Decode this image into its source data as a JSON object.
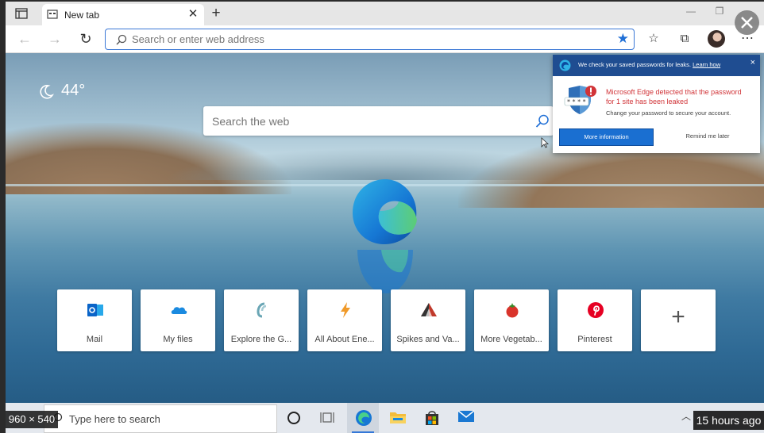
{
  "browser": {
    "tab": {
      "title": "New tab"
    },
    "new_tab_symbol": "+",
    "address_bar": {
      "placeholder": "Search or enter web address"
    },
    "icons": [
      "sidebar-icon",
      "back-icon",
      "forward-icon",
      "refresh-icon",
      "search-icon",
      "favorite-star-icon",
      "favorites-icon",
      "collections-icon",
      "profile-avatar",
      "more-icon"
    ]
  },
  "ntp": {
    "weather": {
      "temperature": "44°",
      "icon": "moon-icon"
    },
    "search": {
      "placeholder": "Search the web"
    },
    "quick_links": [
      {
        "label": "Mail",
        "icon": "outlook-icon",
        "color": "#0a64c8"
      },
      {
        "label": "My files",
        "icon": "onedrive-icon",
        "color": "#1a8ae0"
      },
      {
        "label": "Explore the G...",
        "icon": "link-icon",
        "color": "#6aa6b5"
      },
      {
        "label": "All About Ene...",
        "icon": "lightning-icon",
        "color": "#f09a2a"
      },
      {
        "label": "Spikes and Va...",
        "icon": "triangle-icon",
        "color": "#c0392b"
      },
      {
        "label": "More Vegetab...",
        "icon": "tomato-icon",
        "color": "#d9342b"
      },
      {
        "label": "Pinterest",
        "icon": "pinterest-icon",
        "color": "#e60023"
      }
    ],
    "add_tile_symbol": "+"
  },
  "popup": {
    "header_text": "We check your saved passwords for leaks.",
    "header_link": "Learn how",
    "alert_text": "Microsoft Edge detected that the password for 1 site has been leaked",
    "sub_text": "Change your password to secure your account.",
    "primary_button": "More information",
    "secondary_button": "Remind me later",
    "close_symbol": "×"
  },
  "taskbar": {
    "search_placeholder": "Type here to search",
    "icons": [
      "cortana-icon",
      "task-view-icon",
      "edge-icon",
      "file-explorer-icon",
      "store-icon",
      "mail-icon"
    ]
  },
  "overlay": {
    "dimensions": "960 × 540",
    "time_ago": "15 hours ago"
  },
  "colors": {
    "accent": "#1f6fd6",
    "popup_header": "#1f4d91",
    "alert": "#d13438"
  }
}
